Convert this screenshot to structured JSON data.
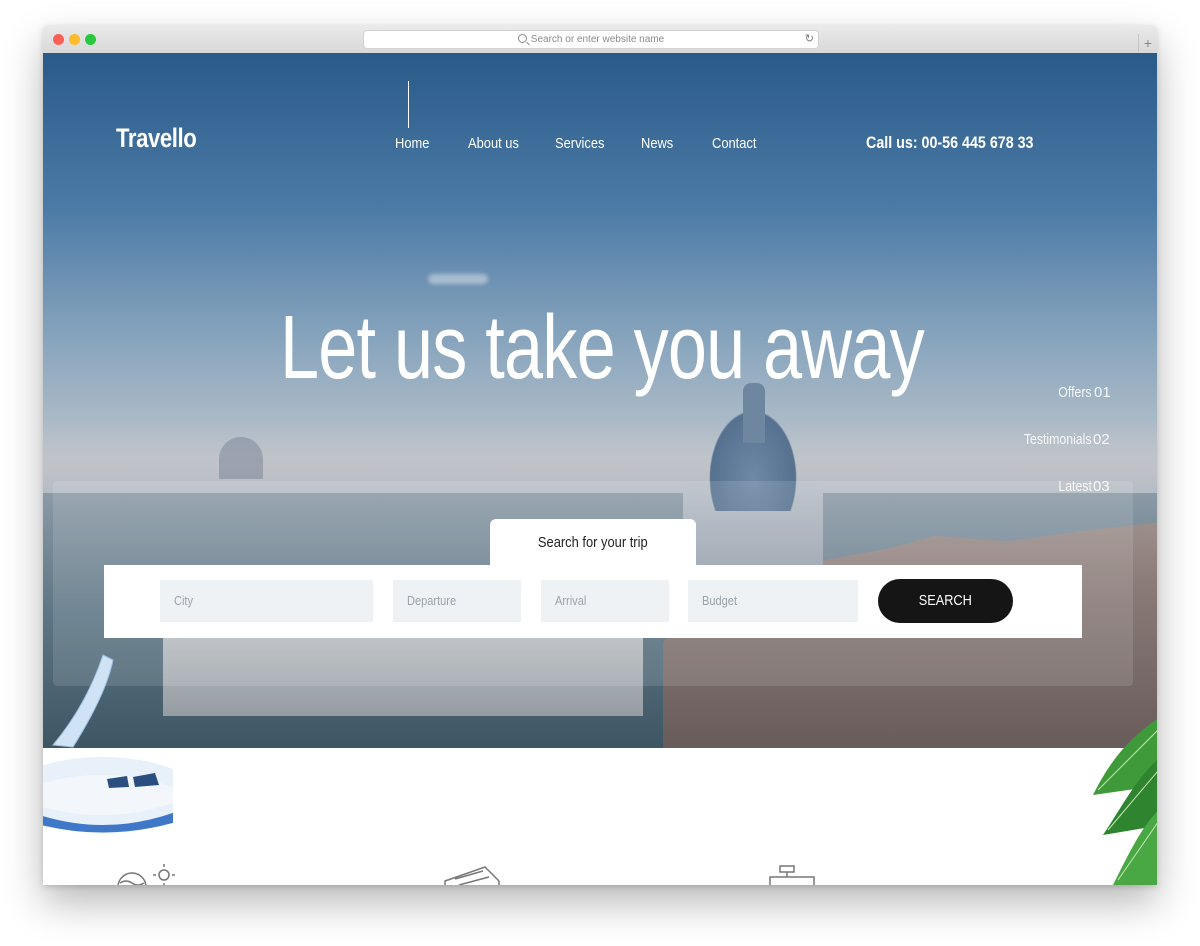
{
  "browser": {
    "url_placeholder": "Search or enter website name",
    "reload_glyph": "↻",
    "newtab_glyph": "+"
  },
  "site": {
    "logo": "Travello",
    "nav": [
      "Home",
      "About us",
      "Services",
      "News",
      "Contact"
    ],
    "active_nav": "Home",
    "phone": "Call us: 00-56 445 678 33"
  },
  "hero": {
    "headline": "Let us take you away",
    "side_menu": [
      {
        "label": "Offers",
        "num": "01"
      },
      {
        "label": "Testimonials",
        "num": "02"
      },
      {
        "label": "Latest",
        "num": "03"
      }
    ]
  },
  "search": {
    "tab_label": "Search for your trip",
    "fields": [
      "City",
      "Departure",
      "Arrival",
      "Budget"
    ],
    "button": "SEARCH"
  },
  "colors": {
    "accent_dark": "#151515",
    "field_bg": "#eff2f4"
  },
  "features": {
    "icons": [
      "sun-wave-icon",
      "ticket-icon",
      "suitcase-icon"
    ]
  }
}
